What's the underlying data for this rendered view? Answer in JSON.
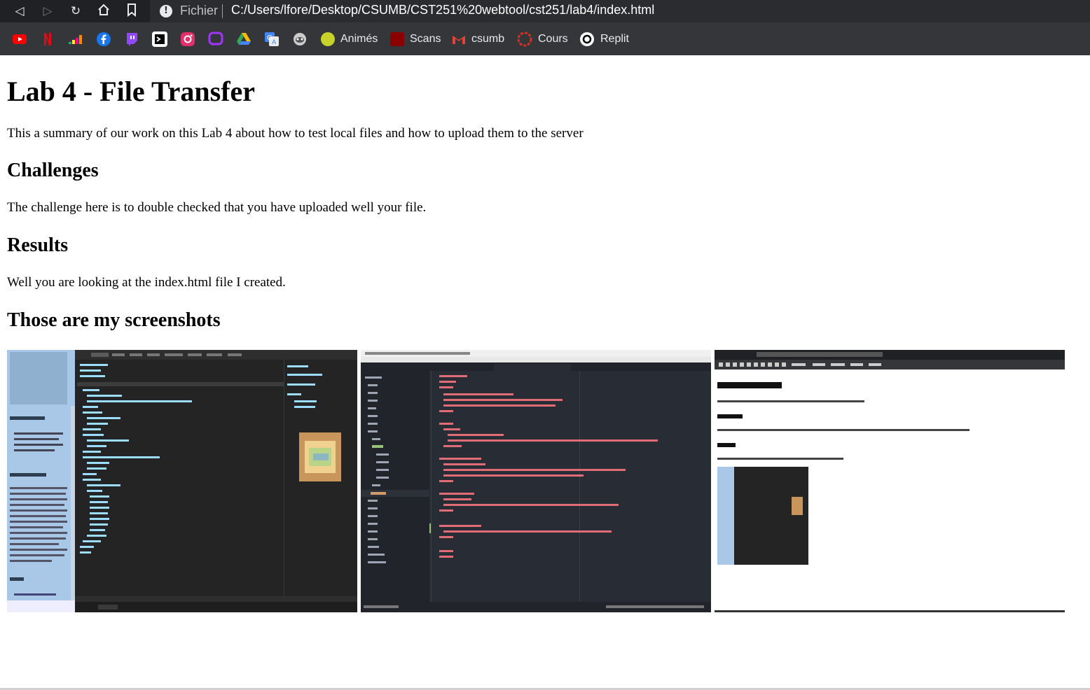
{
  "browser": {
    "nav": {
      "back": "back-icon",
      "forward": "forward-icon",
      "reload": "reload-icon",
      "home": "home-icon",
      "bookmark": "bookmark-icon"
    },
    "address_label": "Fichier",
    "url": "C:/Users/lfore/Desktop/CSUMB/CST251%20webtool/cst251/lab4/index.html",
    "bookmarks": [
      {
        "icon": "youtube-icon",
        "color": "#ff0000"
      },
      {
        "icon": "netflix-icon",
        "color": "#e50914"
      },
      {
        "icon": "deezer-icon",
        "color": "#ff8800"
      },
      {
        "icon": "facebook-icon",
        "color": "#1877f2"
      },
      {
        "icon": "twitch-icon",
        "color": "#9146ff"
      },
      {
        "icon": "app-icon",
        "color": "#ffffff"
      },
      {
        "icon": "instagram-icon",
        "color": "#e1306c"
      },
      {
        "icon": "messenger-icon",
        "color": "#a033ff"
      },
      {
        "icon": "google-drive-icon",
        "color": "#34a853"
      },
      {
        "icon": "google-translate-icon",
        "color": "#4285f4"
      },
      {
        "icon": "app-icon-2",
        "color": "#cccccc"
      }
    ],
    "labeled_bookmarks": [
      {
        "label": "Animés",
        "icon": "animes-icon",
        "color": "#c7d22a"
      },
      {
        "label": "Scans",
        "icon": "scans-icon",
        "color": "#8b0000"
      },
      {
        "label": "csumb",
        "icon": "gmail-icon",
        "color": "#ea4335"
      },
      {
        "label": "Cours",
        "icon": "cours-icon",
        "color": "#d93025"
      },
      {
        "label": "Replit",
        "icon": "replit-icon",
        "color": "#ffffff"
      }
    ]
  },
  "page": {
    "title": "Lab 4 - File Transfer",
    "intro": "This a summary of our work on this Lab 4 about how to test local files and how to upload them to the server",
    "challenges_heading": "Challenges",
    "challenges_text": "The challenge here is to double checked that you have uploaded well your file.",
    "results_heading": "Results",
    "results_text": "Well you are looking at the index.html file I created.",
    "screenshots_heading": "Those are my screenshots",
    "screenshots": [
      {
        "alt": "devtools screenshot"
      },
      {
        "alt": "editor screenshot"
      },
      {
        "alt": "lab 3 page screenshot"
      }
    ]
  }
}
